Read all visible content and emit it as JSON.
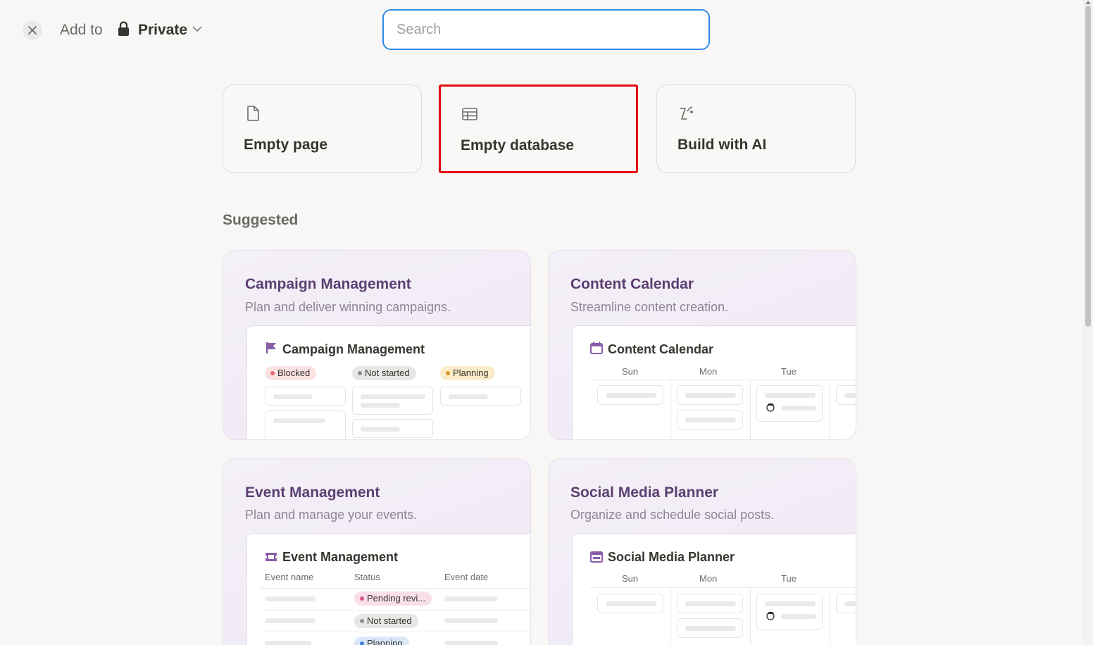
{
  "header": {
    "add_to_label": "Add to",
    "location_label": "Private"
  },
  "search": {
    "placeholder": "Search",
    "value": ""
  },
  "quick_actions": [
    {
      "label": "Empty page",
      "icon": "page-icon"
    },
    {
      "label": "Empty database",
      "icon": "table-icon",
      "selected": true
    },
    {
      "label": "Build with AI",
      "icon": "ai-sparkle-icon"
    }
  ],
  "suggested": {
    "title": "Suggested",
    "templates": [
      {
        "title": "Campaign Management",
        "description": "Plan and deliver winning campaigns.",
        "preview_title": "Campaign Management",
        "preview_icon": "flag-icon",
        "statuses": [
          {
            "label": "Blocked",
            "color": "#e16b6b",
            "bg": "#fbe2e2"
          },
          {
            "label": "Not started",
            "color": "#8e8e8e",
            "bg": "#e8e7e6"
          },
          {
            "label": "Planning",
            "color": "#d89a2b",
            "bg": "#fbecc9"
          }
        ]
      },
      {
        "title": "Content Calendar",
        "description": "Streamline content creation.",
        "preview_title": "Content Calendar",
        "preview_icon": "calendar-icon",
        "days": [
          "Sun",
          "Mon",
          "Tue"
        ]
      },
      {
        "title": "Event Management",
        "description": "Plan and manage your events.",
        "preview_title": "Event Management",
        "preview_icon": "ticket-icon",
        "columns": [
          "Event name",
          "Status",
          "Event date"
        ],
        "statuses": [
          {
            "label": "Pending revi...",
            "color": "#d9558a",
            "bg": "#f9dfe9"
          },
          {
            "label": "Not started",
            "color": "#8e8e8e",
            "bg": "#e8e7e6"
          },
          {
            "label": "Planning",
            "color": "#3b82d6",
            "bg": "#d9e8f8"
          }
        ]
      },
      {
        "title": "Social Media Planner",
        "description": "Organize and schedule social posts.",
        "preview_title": "Social Media Planner",
        "preview_icon": "calendar-board-icon",
        "days": [
          "Sun",
          "Mon",
          "Tue"
        ]
      }
    ]
  },
  "colors": {
    "accent_focus": "#2e8be5",
    "selection_outline": "#e50914",
    "template_title": "#5c3f72",
    "template_icon": "#8a5da8"
  }
}
